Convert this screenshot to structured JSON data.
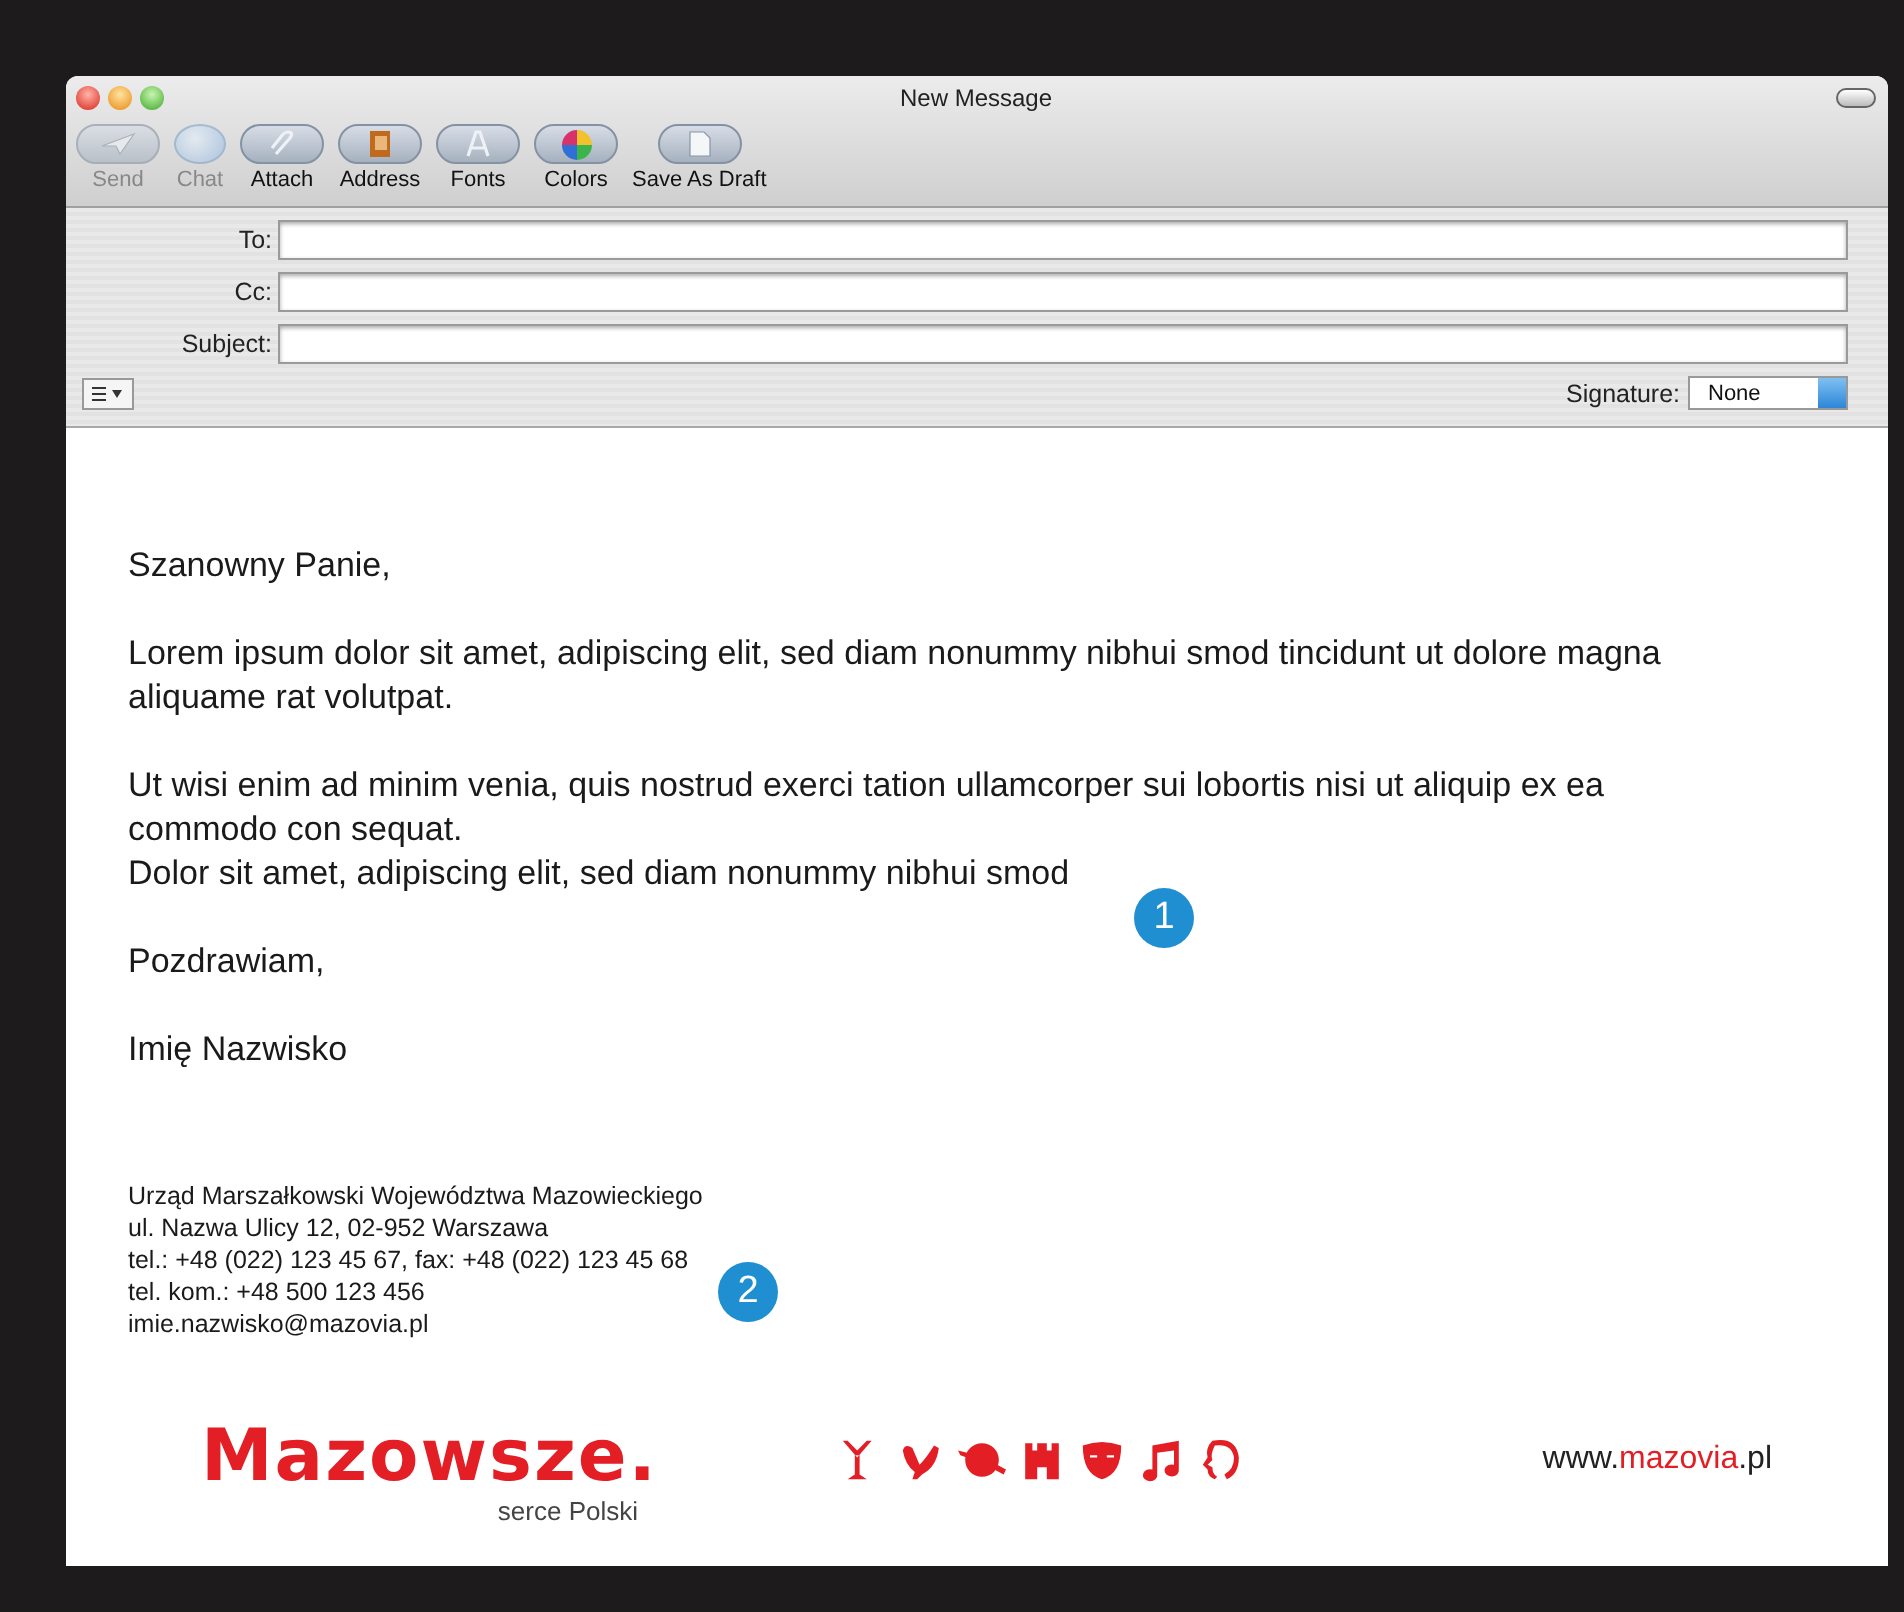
{
  "window": {
    "title": "New Message"
  },
  "toolbar": [
    {
      "label": "Send",
      "kind": "send",
      "disabled": true
    },
    {
      "label": "Chat",
      "kind": "chat",
      "disabled": true
    },
    {
      "label": "Attach",
      "kind": "attach",
      "disabled": false
    },
    {
      "label": "Address",
      "kind": "address",
      "disabled": false
    },
    {
      "label": "Fonts",
      "kind": "fonts",
      "disabled": false
    },
    {
      "label": "Colors",
      "kind": "colors",
      "disabled": false
    },
    {
      "label": "Save As Draft",
      "kind": "draft",
      "disabled": false
    }
  ],
  "fields": [
    {
      "label": "To:"
    },
    {
      "label": "Cc:"
    },
    {
      "label": "Subject:"
    }
  ],
  "signature": {
    "label": "Signature:",
    "value": "None"
  },
  "body": {
    "paragraphs": [
      [
        "Szanowny Panie,"
      ],
      [
        "Lorem ipsum dolor sit amet, adipiscing elit, sed diam nonummy nibhui smod tincidunt ut dolore magna aliquame rat volutpat."
      ],
      [
        "Ut wisi enim ad minim venia, quis nostrud exerci tation ullamcorper sui lobortis nisi ut aliquip ex ea commodo con sequat.",
        "Dolor sit amet, adipiscing elit, sed diam nonummy nibhui smod"
      ],
      [
        "Pozdrawiam,"
      ],
      [
        "Imię Nazwisko"
      ]
    ]
  },
  "contact": [
    "Urząd Marszałkowski Województwa Mazowieckiego",
    "ul. Nazwa Ulicy 12, 02-952 Warszawa",
    "tel.: +48 (022) 123 45 67, fax: +48 (022) 123 45 68",
    "tel. kom.: +48 500 123 456",
    "imie.nazwisko@mazovia.pl"
  ],
  "markers": [
    {
      "label": "1",
      "kind": "body"
    },
    {
      "label": "2",
      "kind": "contact"
    }
  ],
  "footer": {
    "logo": "Mazowsze.",
    "tagline": "serce Polski",
    "website": [
      "www.",
      "mazovia",
      ".pl"
    ]
  }
}
